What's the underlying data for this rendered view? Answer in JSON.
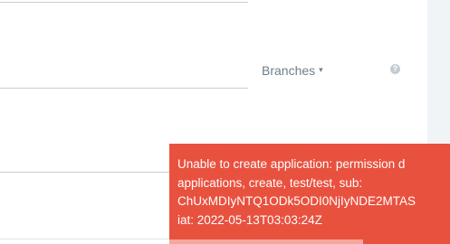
{
  "form": {
    "branches_label": "Branches",
    "branches_caret": "▾",
    "help_glyph": "?"
  },
  "toast": {
    "lines": [
      "Unable to create application: permission d",
      "applications, create, test/test, sub:",
      "ChUxMDIyNTQ1ODk5ODI0NjIyNDE2MTAS",
      "iat: 2022-05-13T03:03:24Z"
    ],
    "progress_fraction": 0.67,
    "background_color": "#e9513f"
  }
}
